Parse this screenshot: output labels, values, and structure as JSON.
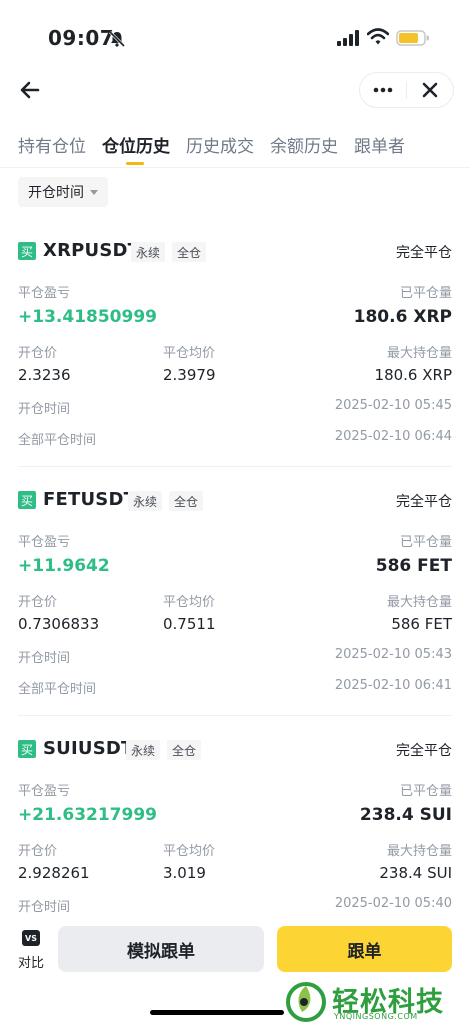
{
  "status_bar": {
    "time": "09:07"
  },
  "tabs": [
    {
      "label": "持有仓位"
    },
    {
      "label": "仓位历史"
    },
    {
      "label": "历史成交"
    },
    {
      "label": "余额历史"
    },
    {
      "label": "跟单者"
    }
  ],
  "active_tab": "仓位历史",
  "filter": {
    "label": "开仓时间"
  },
  "positions": [
    {
      "side": "买",
      "symbol": "XRPUSDT",
      "tag_type": "永续",
      "tag_margin": "全仓",
      "status": "完全平仓",
      "pnl_label": "平仓盈亏",
      "pnl": "+13.41850999",
      "closed_qty_label": "已平仓量",
      "closed_qty": "180.6 XRP",
      "open_price_label": "开仓价",
      "open_price": "2.3236",
      "close_avg_label": "平仓均价",
      "close_avg": "2.3979",
      "max_hold_label": "最大持仓量",
      "max_hold": "180.6 XRP",
      "open_time_label": "开仓时间",
      "open_time": "2025-02-10 05:45",
      "close_time_label": "全部平仓时间",
      "close_time": "2025-02-10 06:44"
    },
    {
      "side": "买",
      "symbol": "FETUSDT",
      "tag_type": "永续",
      "tag_margin": "全仓",
      "status": "完全平仓",
      "pnl_label": "平仓盈亏",
      "pnl": "+11.9642",
      "closed_qty_label": "已平仓量",
      "closed_qty": "586 FET",
      "open_price_label": "开仓价",
      "open_price": "0.7306833",
      "close_avg_label": "平仓均价",
      "close_avg": "0.7511",
      "max_hold_label": "最大持仓量",
      "max_hold": "586 FET",
      "open_time_label": "开仓时间",
      "open_time": "2025-02-10 05:43",
      "close_time_label": "全部平仓时间",
      "close_time": "2025-02-10 06:41"
    },
    {
      "side": "买",
      "symbol": "SUIUSDT",
      "tag_type": "永续",
      "tag_margin": "全仓",
      "status": "完全平仓",
      "pnl_label": "平仓盈亏",
      "pnl": "+21.63217999",
      "closed_qty_label": "已平仓量",
      "closed_qty": "238.4 SUI",
      "open_price_label": "开仓价",
      "open_price": "2.928261",
      "close_avg_label": "平仓均价",
      "close_avg": "3.019",
      "max_hold_label": "最大持仓量",
      "max_hold": "238.4 SUI",
      "open_time_label": "开仓时间",
      "open_time": "2025-02-10 05:40"
    }
  ],
  "bottom_bar": {
    "compare_badge": "VS",
    "compare_label": "对比",
    "simulate_label": "模拟跟单",
    "follow_label": "跟单"
  },
  "watermark": {
    "text": "轻松科技",
    "url": "YNQINGSONG.COM"
  },
  "colors": {
    "accent": "#f0b90b",
    "follow_button": "#fcd535",
    "profit": "#2ebd85",
    "buy_badge": "#2ebd85"
  },
  "icons": [
    "bell-slash-icon",
    "signal-icon",
    "wifi-icon",
    "battery-icon",
    "back-arrow-icon",
    "more-icon",
    "close-icon",
    "caret-down-icon",
    "vs-icon"
  ]
}
